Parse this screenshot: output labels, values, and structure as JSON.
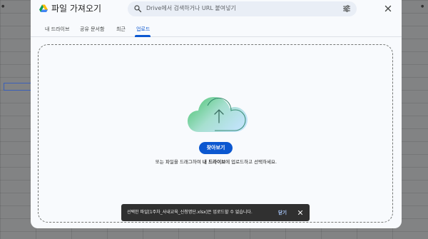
{
  "dialog": {
    "title": "파일 가져오기",
    "search_placeholder": "Drive에서 검색하거나 URL 붙여넣기"
  },
  "tabs": [
    {
      "label": "내 드라이브",
      "active": false
    },
    {
      "label": "공유 문서함",
      "active": false
    },
    {
      "label": "최근",
      "active": false
    },
    {
      "label": "업로드",
      "active": true
    }
  ],
  "upload": {
    "browse_label": "찾아보기",
    "hint_prefix": "또는 파일을 드래그하여 ",
    "hint_bold": "내 드라이브",
    "hint_suffix": "에 업로드하고 선택하세요."
  },
  "snackbar": {
    "message": "선택한 파일[1주차_사내교육_신청명단.xlsx]은 업로드할 수 없습니다.",
    "action": "닫기"
  },
  "icons": {
    "logo": "google-drive-icon",
    "search": "search-icon",
    "filter": "tune-icon",
    "close": "close-icon",
    "cloud": "cloud-upload-icon",
    "snack_close": "close-icon"
  },
  "colors": {
    "accent": "#0b57d0",
    "dialog_bg": "#f8fafd",
    "search_bg": "#e9eef6",
    "snackbar_bg": "#303030",
    "snackbar_action": "#a8c7fa"
  }
}
